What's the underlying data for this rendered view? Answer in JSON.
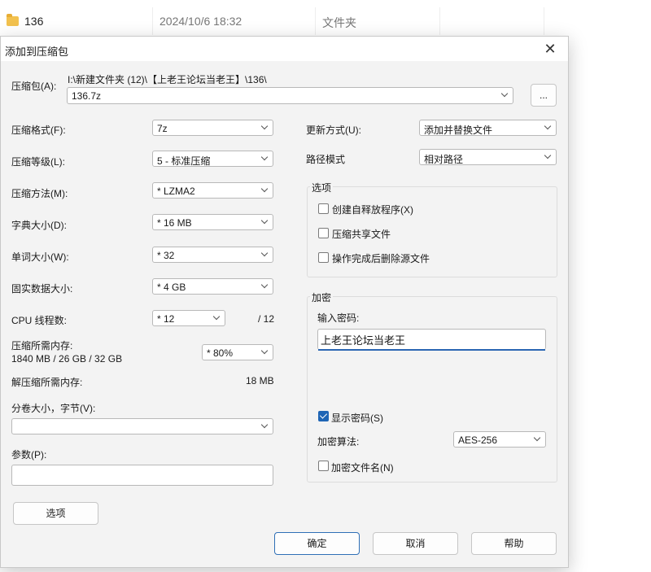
{
  "background": {
    "row": {
      "name": "136",
      "date": "2024/10/6 18:32",
      "type": "文件夹"
    }
  },
  "dialog": {
    "title": "添加到压缩包",
    "archive": {
      "label": "压缩包(A):",
      "path": "I:\\新建文件夹 (12)\\【上老王论坛当老王】\\136\\",
      "filename": "136.7z",
      "browse_label": "..."
    },
    "left": {
      "format": {
        "label": "压缩格式(F):",
        "value": "7z"
      },
      "level": {
        "label": "压缩等级(L):",
        "value": "5 - 标准压缩"
      },
      "method": {
        "label": "压缩方法(M):",
        "value": "*  LZMA2"
      },
      "dict": {
        "label": "字典大小(D):",
        "value": "*  16 MB"
      },
      "word": {
        "label": "单词大小(W):",
        "value": "*  32"
      },
      "solid": {
        "label": "固实数据大小:",
        "value": "*  4 GB"
      },
      "cpu": {
        "label": "CPU 线程数:",
        "value": "*  12",
        "max": "/ 12"
      },
      "mem": {
        "label": "压缩所需内存:",
        "detail": "1840 MB / 26 GB / 32 GB",
        "value": "*  80%"
      },
      "decomp": {
        "label": "解压缩所需内存:",
        "value": "18 MB"
      },
      "split": {
        "label": "分卷大小，字节(V):",
        "value": ""
      },
      "params": {
        "label": "参数(P):",
        "value": ""
      },
      "options_button": "选项"
    },
    "right": {
      "update": {
        "label": "更新方式(U):",
        "value": "添加并替换文件"
      },
      "pathmode": {
        "label": "路径模式",
        "value": "相对路径"
      },
      "options": {
        "title": "选项",
        "sfx": "创建自释放程序(X)",
        "shared": "压缩共享文件",
        "delete": "操作完成后删除源文件"
      },
      "encryption": {
        "title": "加密",
        "pwd_label": "输入密码:",
        "pwd_value": "上老王论坛当老王",
        "show_pwd": "显示密码(S)",
        "method_label": "加密算法:",
        "method_value": "AES-256",
        "encrypt_names": "加密文件名(N)"
      }
    },
    "buttons": {
      "ok": "确定",
      "cancel": "取消",
      "help": "帮助"
    }
  },
  "colors": {
    "accent": "#1f65b5",
    "dialog_bg": "#f3f3f3"
  }
}
